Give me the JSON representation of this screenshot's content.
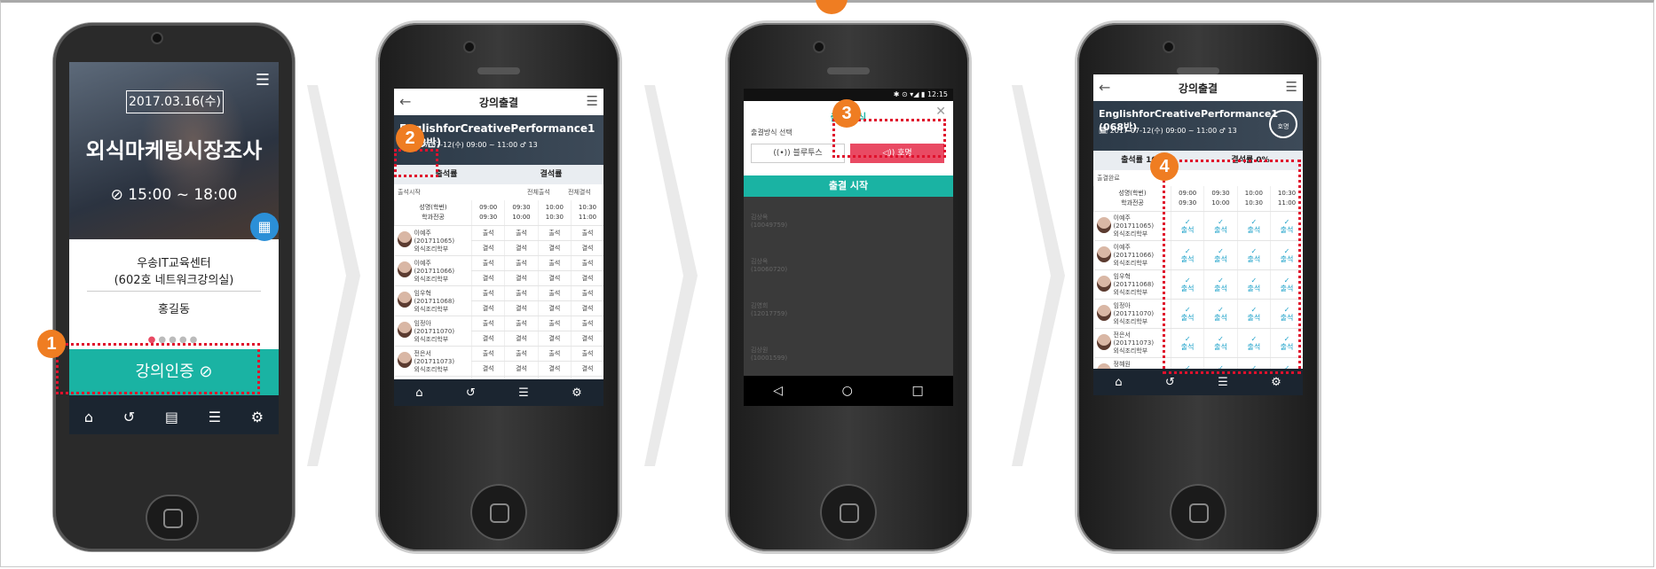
{
  "screen1": {
    "date": "2017.03.16(수)",
    "title": "외식마케팅시장조사",
    "time": "⊘ 15:00 ~ 18:00",
    "place_line1": "우송IT교육센터",
    "place_line2": "(602호 네트워크강의실)",
    "person": "홍길동",
    "auth_button": "강의인증 ⊘",
    "dots": "●●●●●"
  },
  "screen2": {
    "header_title": "강의출결",
    "course": "EnglishforCreativePerformance1 (068반)",
    "course_info": "🗓 2017-07-12(수) 09:00 ~ 11:00 ♂ 13",
    "rate_present": "출석률",
    "rate_absent": "결석률",
    "opt_start": "출석시작",
    "opt_all_present": "전체출석",
    "opt_all_absent": "전체결석",
    "col_name": "성명(학번)",
    "col_dept": "학과전공",
    "times_top": [
      "09:00",
      "09:30",
      "10:00",
      "10:30"
    ],
    "times_bottom": [
      "09:30",
      "10:00",
      "10:30",
      "11:00"
    ],
    "students": [
      {
        "name": "이예주",
        "id": "(201711065)",
        "dept": "외식조리학부",
        "r1": [
          "출석",
          "출석",
          "출석",
          "출석"
        ],
        "r2": [
          "결석",
          "결석",
          "결석",
          "결석"
        ]
      },
      {
        "name": "이예주",
        "id": "(201711066)",
        "dept": "외식조리학부",
        "r1": [
          "출석",
          "출석",
          "출석",
          "출석"
        ],
        "r2": [
          "결석",
          "결석",
          "결석",
          "결석"
        ]
      },
      {
        "name": "임우혁",
        "id": "(201711068)",
        "dept": "외식조리학부",
        "r1": [
          "출석",
          "출석",
          "출석",
          "출석"
        ],
        "r2": [
          "결석",
          "결석",
          "결석",
          "결석"
        ]
      },
      {
        "name": "임정아",
        "id": "(201711070)",
        "dept": "외식조리학부",
        "r1": [
          "출석",
          "출석",
          "출석",
          "출석"
        ],
        "r2": [
          "결석",
          "결석",
          "결석",
          "결석"
        ]
      },
      {
        "name": "전은서",
        "id": "(201711073)",
        "dept": "외식조리학부",
        "r1": [
          "출석",
          "출석",
          "출석",
          "출석"
        ],
        "r2": [
          "결석",
          "결석",
          "결석",
          "결석"
        ]
      },
      {
        "name": "정혜원",
        "id": "(201711082)",
        "dept": "외식조리학부",
        "r1": [
          "출석",
          "출석",
          "출석",
          "출석"
        ],
        "r2": [
          "결석",
          "결석",
          "결석",
          "결석"
        ]
      }
    ]
  },
  "screen3": {
    "status": "✱ ⊙ ▾◢ ▮ 12:15",
    "modal_title": "출결방식",
    "select_label": "출결방식 선택",
    "bluetooth": "((•)) 블루투스",
    "call": "◁)) 호명",
    "start": "출결 시작"
  },
  "screen4": {
    "header_title": "강의출결",
    "course": "EnglishforCreativePerformance1 (068반)",
    "course_info": "🗓 2017-07-12(수) 09:00 ~ 11:00 ♂ 13",
    "call_badge": "호명",
    "rate_present": "출석률 100%",
    "rate_absent": "결석률 0%",
    "done": "출결완료",
    "check_mark": "✓",
    "present": "출석"
  },
  "badges": [
    "1",
    "2",
    "3",
    "4"
  ]
}
